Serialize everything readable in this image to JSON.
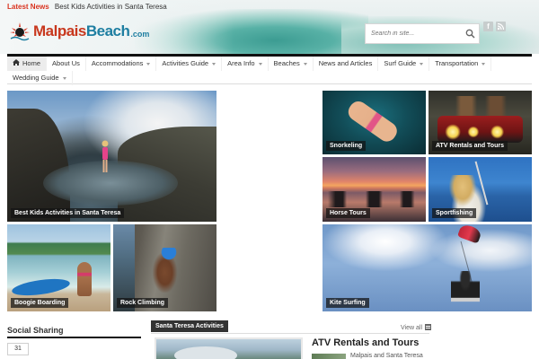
{
  "header": {
    "latest_news_label": "Latest News",
    "latest_news_text": "Best Kids Activities in Santa Teresa",
    "logo_part1": "Malpais",
    "logo_part2": "Beach",
    "logo_domain": ".com",
    "search_placeholder": "Search in site...",
    "social_icons": [
      "facebook-icon",
      "rss-icon"
    ]
  },
  "nav": {
    "row1": [
      {
        "label": "Home",
        "active": true,
        "has_caret": false,
        "icon": "home-icon"
      },
      {
        "label": "About Us",
        "has_caret": false
      },
      {
        "label": "Accommodations",
        "has_caret": true
      },
      {
        "label": "Activities Guide",
        "has_caret": true
      },
      {
        "label": "Area Info",
        "has_caret": true
      },
      {
        "label": "Beaches",
        "has_caret": true
      },
      {
        "label": "News and Articles",
        "has_caret": false
      },
      {
        "label": "Surf Guide",
        "has_caret": true
      },
      {
        "label": "Transportation",
        "has_caret": true
      }
    ],
    "row2": [
      {
        "label": "Wedding Guide",
        "has_caret": true
      }
    ]
  },
  "tiles": {
    "t1": "Best Kids Activities in Santa Teresa",
    "t2": "Boogie Boarding",
    "t3": "Rock Climbing",
    "t4": "Snorkeling",
    "t5": "ATV Rentals and Tours",
    "t6": "Horse Tours",
    "t7": "Sportfishing",
    "t8": "Kite Surfing"
  },
  "sidebar": {
    "social_title": "Social Sharing",
    "share_count": "31"
  },
  "section": {
    "category_label": "Santa Teresa Activities",
    "view_all": "View all",
    "post_title": "ATV Rentals and Tours",
    "post_meta": "Malpais and Santa Teresa"
  },
  "colors": {
    "accent_red": "#d9331f",
    "logo_blue": "#1e7ea1",
    "nav_border": "#111111"
  }
}
